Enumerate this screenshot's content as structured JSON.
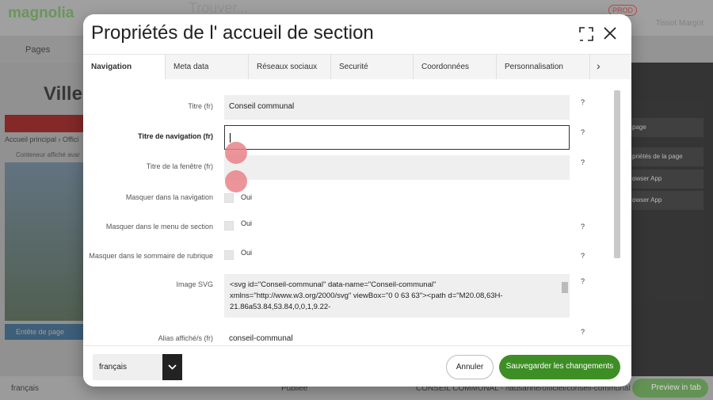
{
  "background": {
    "logo": "magnolia",
    "search_placeholder": "Trouver...",
    "prod_badge": "PROD",
    "user": "Tissot Margot",
    "pages_label": "Pages",
    "ville": "Ville",
    "breadcrumb": "Accueil principal › Offici",
    "container_text": "Conteneur affiché avar",
    "entete": "Entête de page",
    "right_items": [
      "page",
      "priétés de la page",
      "owser App",
      "owser App"
    ],
    "bottom_lang": "français",
    "bottom_status": "Publiée",
    "bottom_path": "CONSEIL COMMUNAL - /lausanne/officiel/conseil-communal",
    "preview_btn": "Preview in tab"
  },
  "dialog": {
    "title": "Propriétés de l' accueil de section",
    "tabs": [
      "Navigation",
      "Meta data",
      "Réseaux sociaux",
      "Securité",
      "Coordonnées",
      "Personnalisation"
    ],
    "fields": {
      "titre_label": "Titre (fr)",
      "titre_value": "Conseil communal",
      "nav_label": "Titre de navigation (fr)",
      "nav_value": "",
      "fenetre_label": "Titre de la fenêtre (fr)",
      "fenetre_value": "",
      "masquer_nav_label": "Masquer dans la navigation",
      "masquer_section_label": "Masquer dans le menu de section",
      "masquer_sommaire_label": "Masquer dans le sommaire de rubrique",
      "oui": "Oui",
      "svg_label": "Image SVG",
      "svg_value": "<svg id=\"Conseil-communal\" data-name=\"Conseil-communal\" xmlns=\"http://www.w3.org/2000/svg\" viewBox=\"0 0 63 63\"><path d=\"M20.08,63H-21.86a53.84,53.84,0,0,1,9.22-",
      "alias_label": "Alias affiché/s (fr)",
      "alias_value": "conseil-communal",
      "help": "?"
    },
    "footer": {
      "language": "français",
      "cancel": "Annuler",
      "save": "Sauvegarder les changements"
    }
  },
  "colors": {
    "brand_green": "#3e8e26",
    "highlight_dot": "#e8838a"
  }
}
